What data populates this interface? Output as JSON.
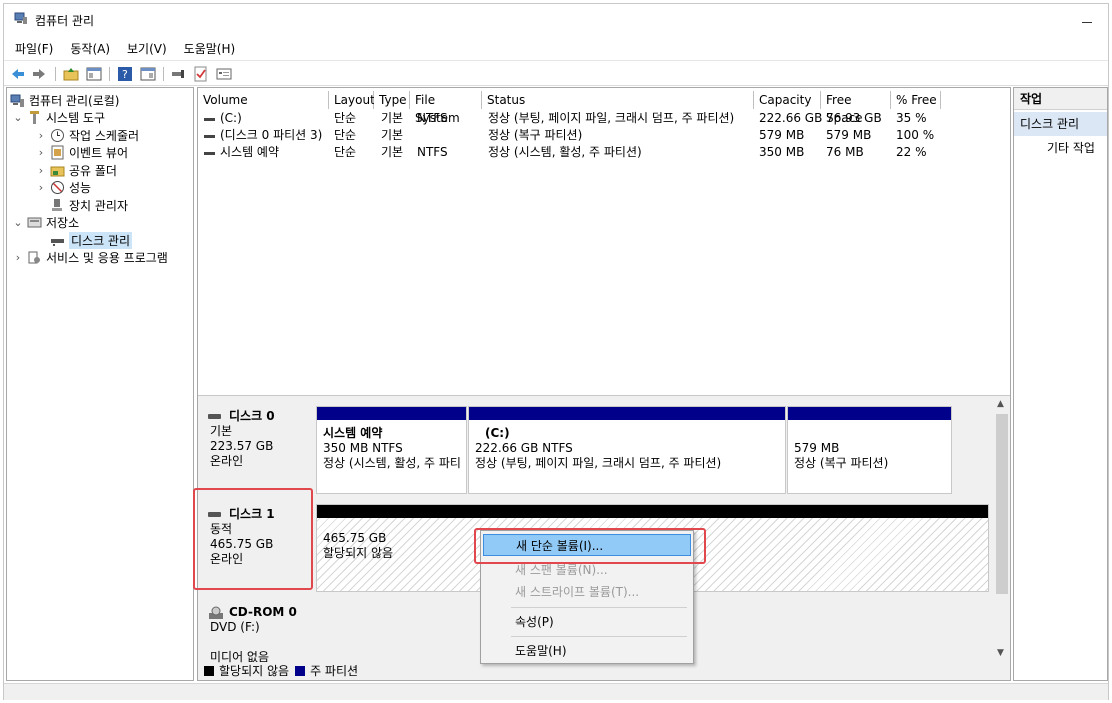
{
  "window": {
    "title": "컴퓨터 관리"
  },
  "menu": [
    "파일(F)",
    "동작(A)",
    "보기(V)",
    "도움말(H)"
  ],
  "tree": {
    "root": "컴퓨터 관리(로컬)",
    "system_tools": "시스템 도구",
    "task_scheduler": "작업 스케줄러",
    "event_viewer": "이벤트 뷰어",
    "shared_folders": "공유 폴더",
    "performance": "성능",
    "device_manager": "장치 관리자",
    "storage": "저장소",
    "disk_management": "디스크 관리",
    "services": "서비스 및 응용 프로그램"
  },
  "volumes": {
    "columns": [
      "Volume",
      "Layout",
      "Type",
      "File System",
      "Status",
      "Capacity",
      "Free Space",
      "% Free"
    ],
    "rows": [
      [
        "(C:)",
        "단순",
        "기본",
        "NTFS",
        "정상 (부팅, 페이지 파일, 크래시 덤프, 주 파티션)",
        "222.66 GB",
        "76.93 GB",
        "35 %"
      ],
      [
        "(디스크 0 파티션 3)",
        "단순",
        "기본",
        "",
        "정상 (복구 파티션)",
        "579 MB",
        "579 MB",
        "100 %"
      ],
      [
        "시스템 예약",
        "단순",
        "기본",
        "NTFS",
        "정상 (시스템, 활성, 주 파티션)",
        "350 MB",
        "76 MB",
        "22 %"
      ]
    ]
  },
  "disk0": {
    "name": "디스크 0",
    "type": "기본",
    "size": "223.57 GB",
    "state": "온라인",
    "parts": [
      {
        "title": "시스템 예약",
        "size": "350 MB NTFS",
        "status": "정상 (시스템, 활성, 주 파티"
      },
      {
        "title": "(C:)",
        "size": "222.66 GB NTFS",
        "status": "정상 (부팅, 페이지 파일, 크래시 덤프, 주 파티션)"
      },
      {
        "title": "",
        "size": "579 MB",
        "status": "정상 (복구 파티션)"
      }
    ]
  },
  "disk1": {
    "name": "디스크 1",
    "type": "동적",
    "size": "465.75 GB",
    "state": "온라인",
    "part": {
      "size": "465.75 GB",
      "status": "할당되지 않음"
    }
  },
  "cdrom": {
    "name": "CD-ROM 0",
    "type": "DVD (F:)",
    "state": "미디어 없음"
  },
  "legend": {
    "unallocated": "할당되지 않음",
    "primary": "주 파티션"
  },
  "context_menu": {
    "new_simple": "새 단순 볼륨(I)...",
    "new_spanned": "새 스팬 볼륨(N)...",
    "new_striped": "새 스트라이프 볼륨(T)...",
    "properties": "속성(P)",
    "help": "도움말(H)"
  },
  "actions": {
    "header": "작업",
    "section": "디스크 관리",
    "more": "기타 작업"
  },
  "colors": {
    "primary_partition": "#00008b",
    "unallocated": "#000000",
    "highlight": "#e0484d",
    "menu_hover": "#91c9f7"
  }
}
